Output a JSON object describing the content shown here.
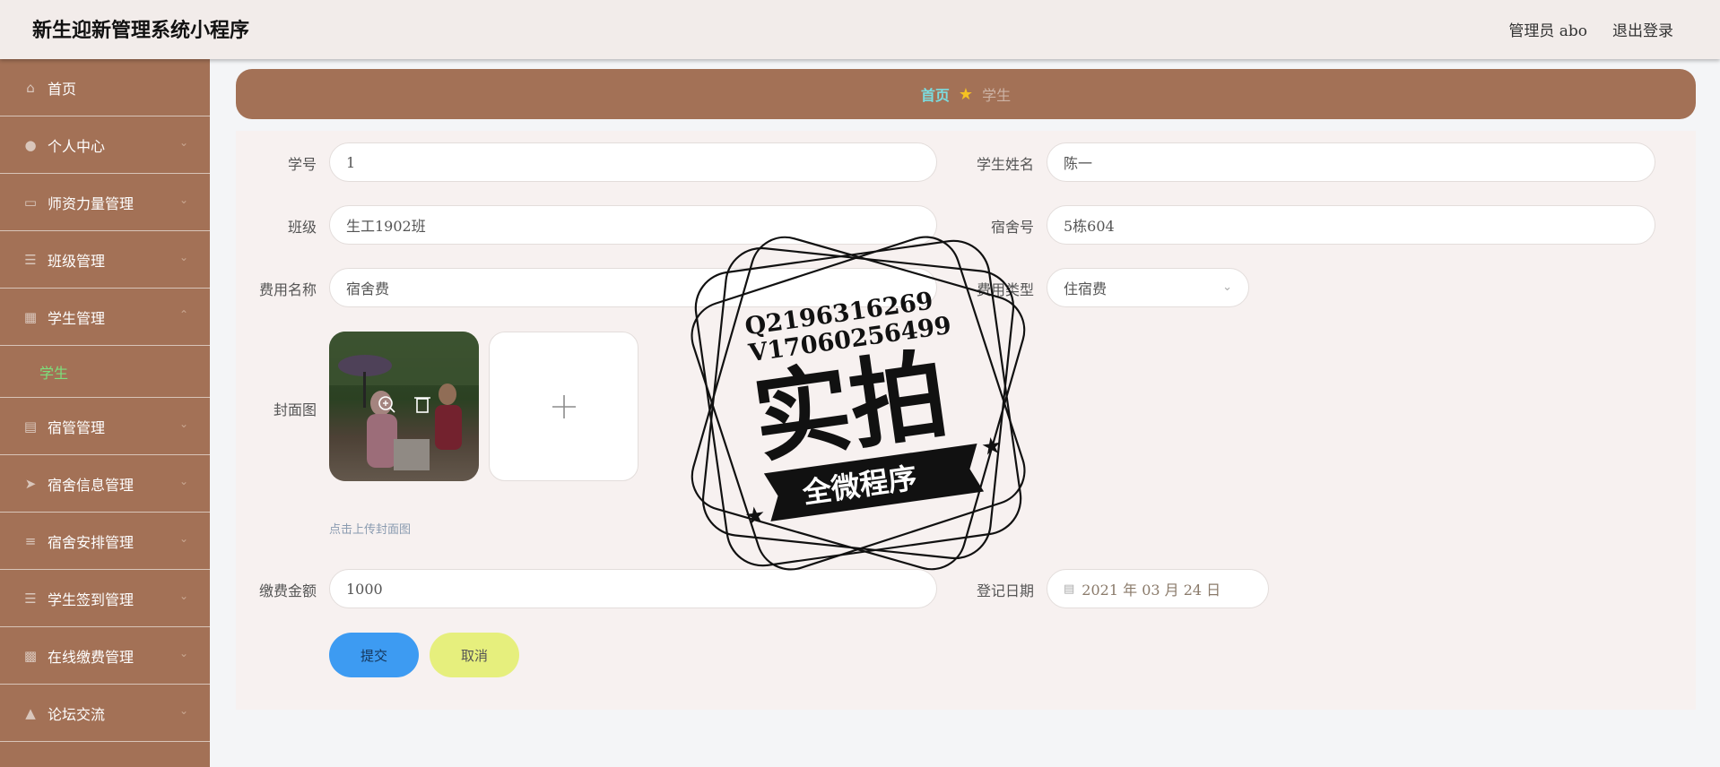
{
  "header": {
    "app_title": "新生迎新管理系统小程序",
    "admin": "管理员 abo",
    "logout": "退出登录"
  },
  "sidebar": {
    "items": [
      {
        "label": "首页",
        "icon": "home-icon"
      },
      {
        "label": "个人中心",
        "icon": "user-icon"
      },
      {
        "label": "师资力量管理",
        "icon": "monitor-icon"
      },
      {
        "label": "班级管理",
        "icon": "list-icon"
      },
      {
        "label": "学生管理",
        "icon": "briefcase-icon",
        "expanded": true
      },
      {
        "label": "宿管管理",
        "icon": "clipboard-icon"
      },
      {
        "label": "宿舍信息管理",
        "icon": "send-icon"
      },
      {
        "label": "宿舍安排管理",
        "icon": "sliders-icon"
      },
      {
        "label": "学生签到管理",
        "icon": "list-icon"
      },
      {
        "label": "在线缴费管理",
        "icon": "calendar-icon"
      },
      {
        "label": "论坛交流",
        "icon": "pin-icon"
      }
    ],
    "sub_item": "学生",
    "accent_color": "#a37156"
  },
  "breadcrumb": {
    "home": "首页",
    "current": "学生"
  },
  "form": {
    "student_id_label": "学号",
    "student_id": "1",
    "name_label": "学生姓名",
    "name": "陈一",
    "class_label": "班级",
    "class": "生工1902班",
    "dorm_label": "宿舍号",
    "dorm": "5栋604",
    "fee_name_label": "费用名称",
    "fee_name": "宿舍费",
    "fee_type_label": "费用类型",
    "fee_type": "住宿费",
    "cover_label": "封面图",
    "upload_hint": "点击上传封面图",
    "amount_label": "缴费金额",
    "amount": "1000",
    "date_label": "登记日期",
    "date": "2021 年 03 月 24 日",
    "submit": "提交",
    "cancel": "取消"
  },
  "watermark": {
    "line1": "Q2196316269",
    "line2": "V17060256499",
    "main": "实拍",
    "banner": "全微程序"
  }
}
